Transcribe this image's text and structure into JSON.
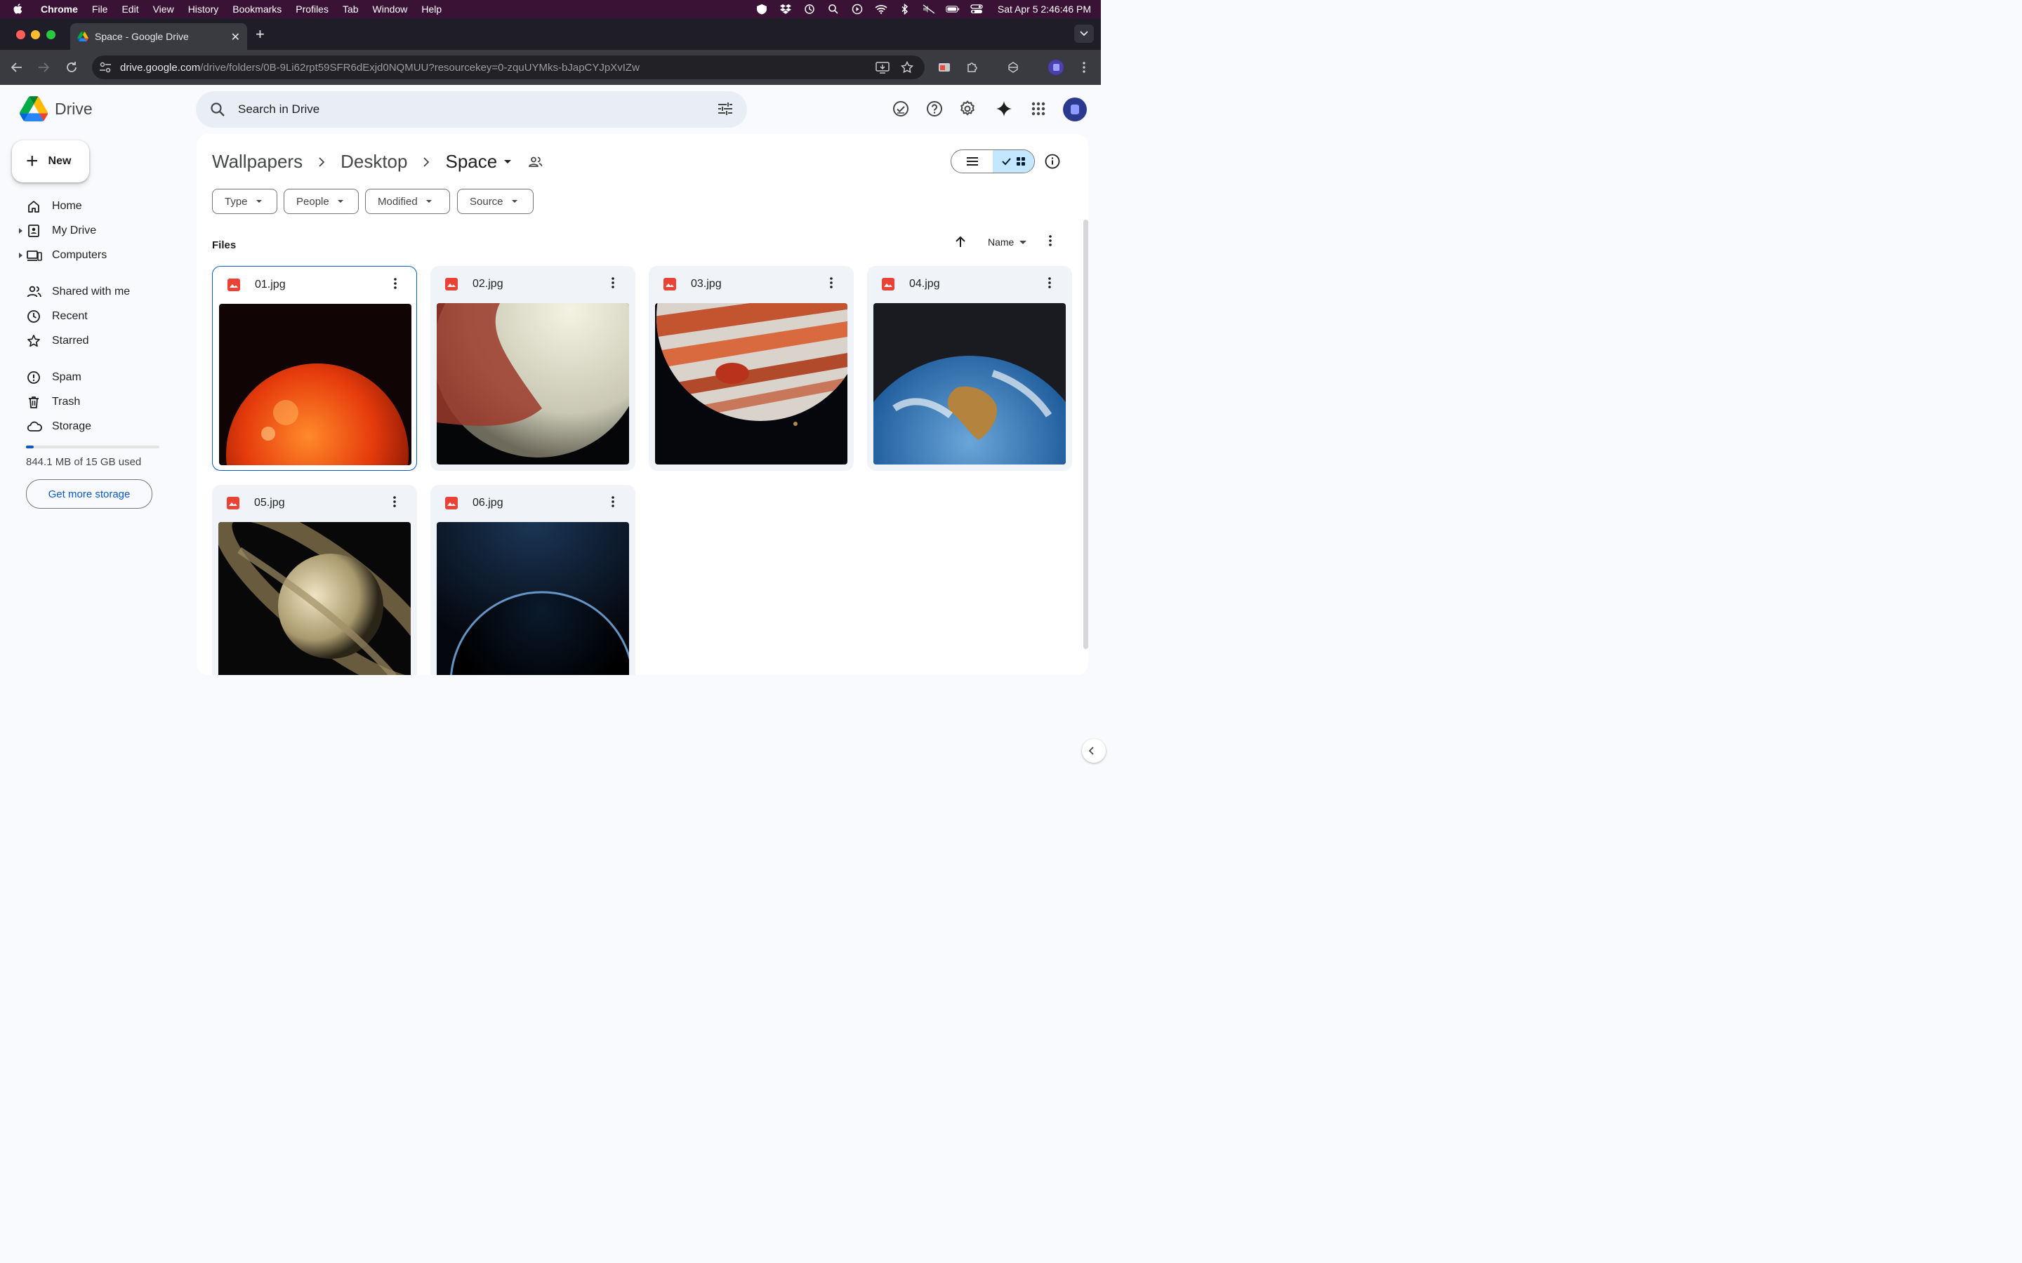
{
  "menubar": {
    "app": "Chrome",
    "items": [
      "File",
      "Edit",
      "View",
      "History",
      "Bookmarks",
      "Profiles",
      "Tab",
      "Window",
      "Help"
    ],
    "clock": "Sat Apr 5  2:46:46 PM"
  },
  "browser": {
    "tab_title": "Space - Google Drive",
    "url_host": "drive.google.com",
    "url_path": "/drive/folders/0B-9Li62rpt59SFR6dExjd0NQMUU?resourcekey=0-zquUYMks-bJapCYJpXvIZw"
  },
  "drive": {
    "logo_text": "Drive",
    "search_placeholder": "Search in Drive",
    "new_label": "New",
    "nav": {
      "home": "Home",
      "my_drive": "My Drive",
      "computers": "Computers",
      "shared": "Shared with me",
      "recent": "Recent",
      "starred": "Starred",
      "spam": "Spam",
      "trash": "Trash",
      "storage": "Storage"
    },
    "storage_text": "844.1 MB of 15 GB used",
    "storage_fraction": 0.056,
    "get_more_label": "Get more storage",
    "breadcrumb": [
      "Wallpapers",
      "Desktop",
      "Space"
    ],
    "filters": [
      "Type",
      "People",
      "Modified",
      "Source"
    ],
    "files_label": "Files",
    "sort_label": "Name",
    "files": [
      {
        "name": "01.jpg",
        "selected": true
      },
      {
        "name": "02.jpg",
        "selected": false
      },
      {
        "name": "03.jpg",
        "selected": false
      },
      {
        "name": "04.jpg",
        "selected": false
      },
      {
        "name": "05.jpg",
        "selected": false
      },
      {
        "name": "06.jpg",
        "selected": false
      }
    ]
  },
  "colors": {
    "accent": "#0b57d0",
    "selected_view": "#c2e7ff",
    "image_icon": "#ea4335"
  }
}
